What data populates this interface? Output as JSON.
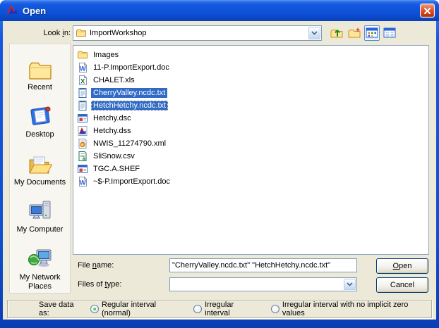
{
  "window": {
    "title": "Open"
  },
  "colors": {
    "titlebar_blue": "#1557DD",
    "selection_blue": "#316AC5",
    "dialog_face": "#ECE9D8",
    "close_red": "#C83B12",
    "radio_green": "#2DA32D"
  },
  "labels": {
    "look_in": {
      "pre": "Look ",
      "mn": "i",
      "post": "n:"
    },
    "file_name": {
      "pre": "File ",
      "mn": "n",
      "post": "ame:"
    },
    "files_of_type": {
      "pre": "Files of ",
      "mn": "t",
      "post": "ype:"
    }
  },
  "look_in": {
    "folder_value": "ImportWorkshop",
    "folder_icon": "folder-icon",
    "arrow_icon": "chevron-down-icon"
  },
  "toolbar": {
    "buttons": [
      {
        "icon": "up-one-level-icon",
        "active": false
      },
      {
        "icon": "new-folder-icon",
        "active": false
      },
      {
        "icon": "list-view-icon",
        "active": true
      },
      {
        "icon": "details-view-icon",
        "active": false
      }
    ]
  },
  "places": [
    {
      "label": "Recent",
      "icon": "recent-folder-icon"
    },
    {
      "label": "Desktop",
      "icon": "desktop-icon"
    },
    {
      "label": "My Documents",
      "icon": "my-documents-icon"
    },
    {
      "label": "My Computer",
      "icon": "my-computer-icon"
    },
    {
      "label": "My Network Places",
      "icon": "network-places-icon"
    }
  ],
  "files": [
    {
      "name": "Images",
      "icon": "folder-icon",
      "selected": false,
      "focused": false
    },
    {
      "name": "11-P.ImportExport.doc",
      "icon": "word-doc-icon",
      "selected": false,
      "focused": false
    },
    {
      "name": "CHALET.xls",
      "icon": "excel-icon",
      "selected": false,
      "focused": false
    },
    {
      "name": "CherryValley.ncdc.txt",
      "icon": "text-file-icon",
      "selected": true,
      "focused": false
    },
    {
      "name": "HetchHetchy.ncdc.txt",
      "icon": "text-file-icon",
      "selected": true,
      "focused": true
    },
    {
      "name": "Hetchy.dsc",
      "icon": "app-window-icon",
      "selected": false,
      "focused": false
    },
    {
      "name": "Hetchy.dss",
      "icon": "dss-icon",
      "selected": false,
      "focused": false
    },
    {
      "name": "NWIS_11274790.xml",
      "icon": "xml-icon",
      "selected": false,
      "focused": false
    },
    {
      "name": "SliSnow.csv",
      "icon": "csv-icon",
      "selected": false,
      "focused": false
    },
    {
      "name": "TGC.A.SHEF",
      "icon": "app-window-icon",
      "selected": false,
      "focused": false
    },
    {
      "name": "~$-P.ImportExport.doc",
      "icon": "word-doc-icon",
      "selected": false,
      "focused": false
    }
  ],
  "fields": {
    "file_name_value": "\"CherryValley.ncdc.txt\" \"HetchHetchy.ncdc.txt\"",
    "files_of_type_value": ""
  },
  "buttons": {
    "open": {
      "pre": "",
      "mn": "O",
      "post": "pen"
    },
    "cancel": "Cancel"
  },
  "save_data_as": {
    "label": "Save data as:",
    "options": [
      {
        "label": "Regular interval (normal)",
        "selected": true
      },
      {
        "label": "Irregular interval",
        "selected": false
      },
      {
        "label": "Irregular interval with no implicit zero values",
        "selected": false
      }
    ]
  }
}
